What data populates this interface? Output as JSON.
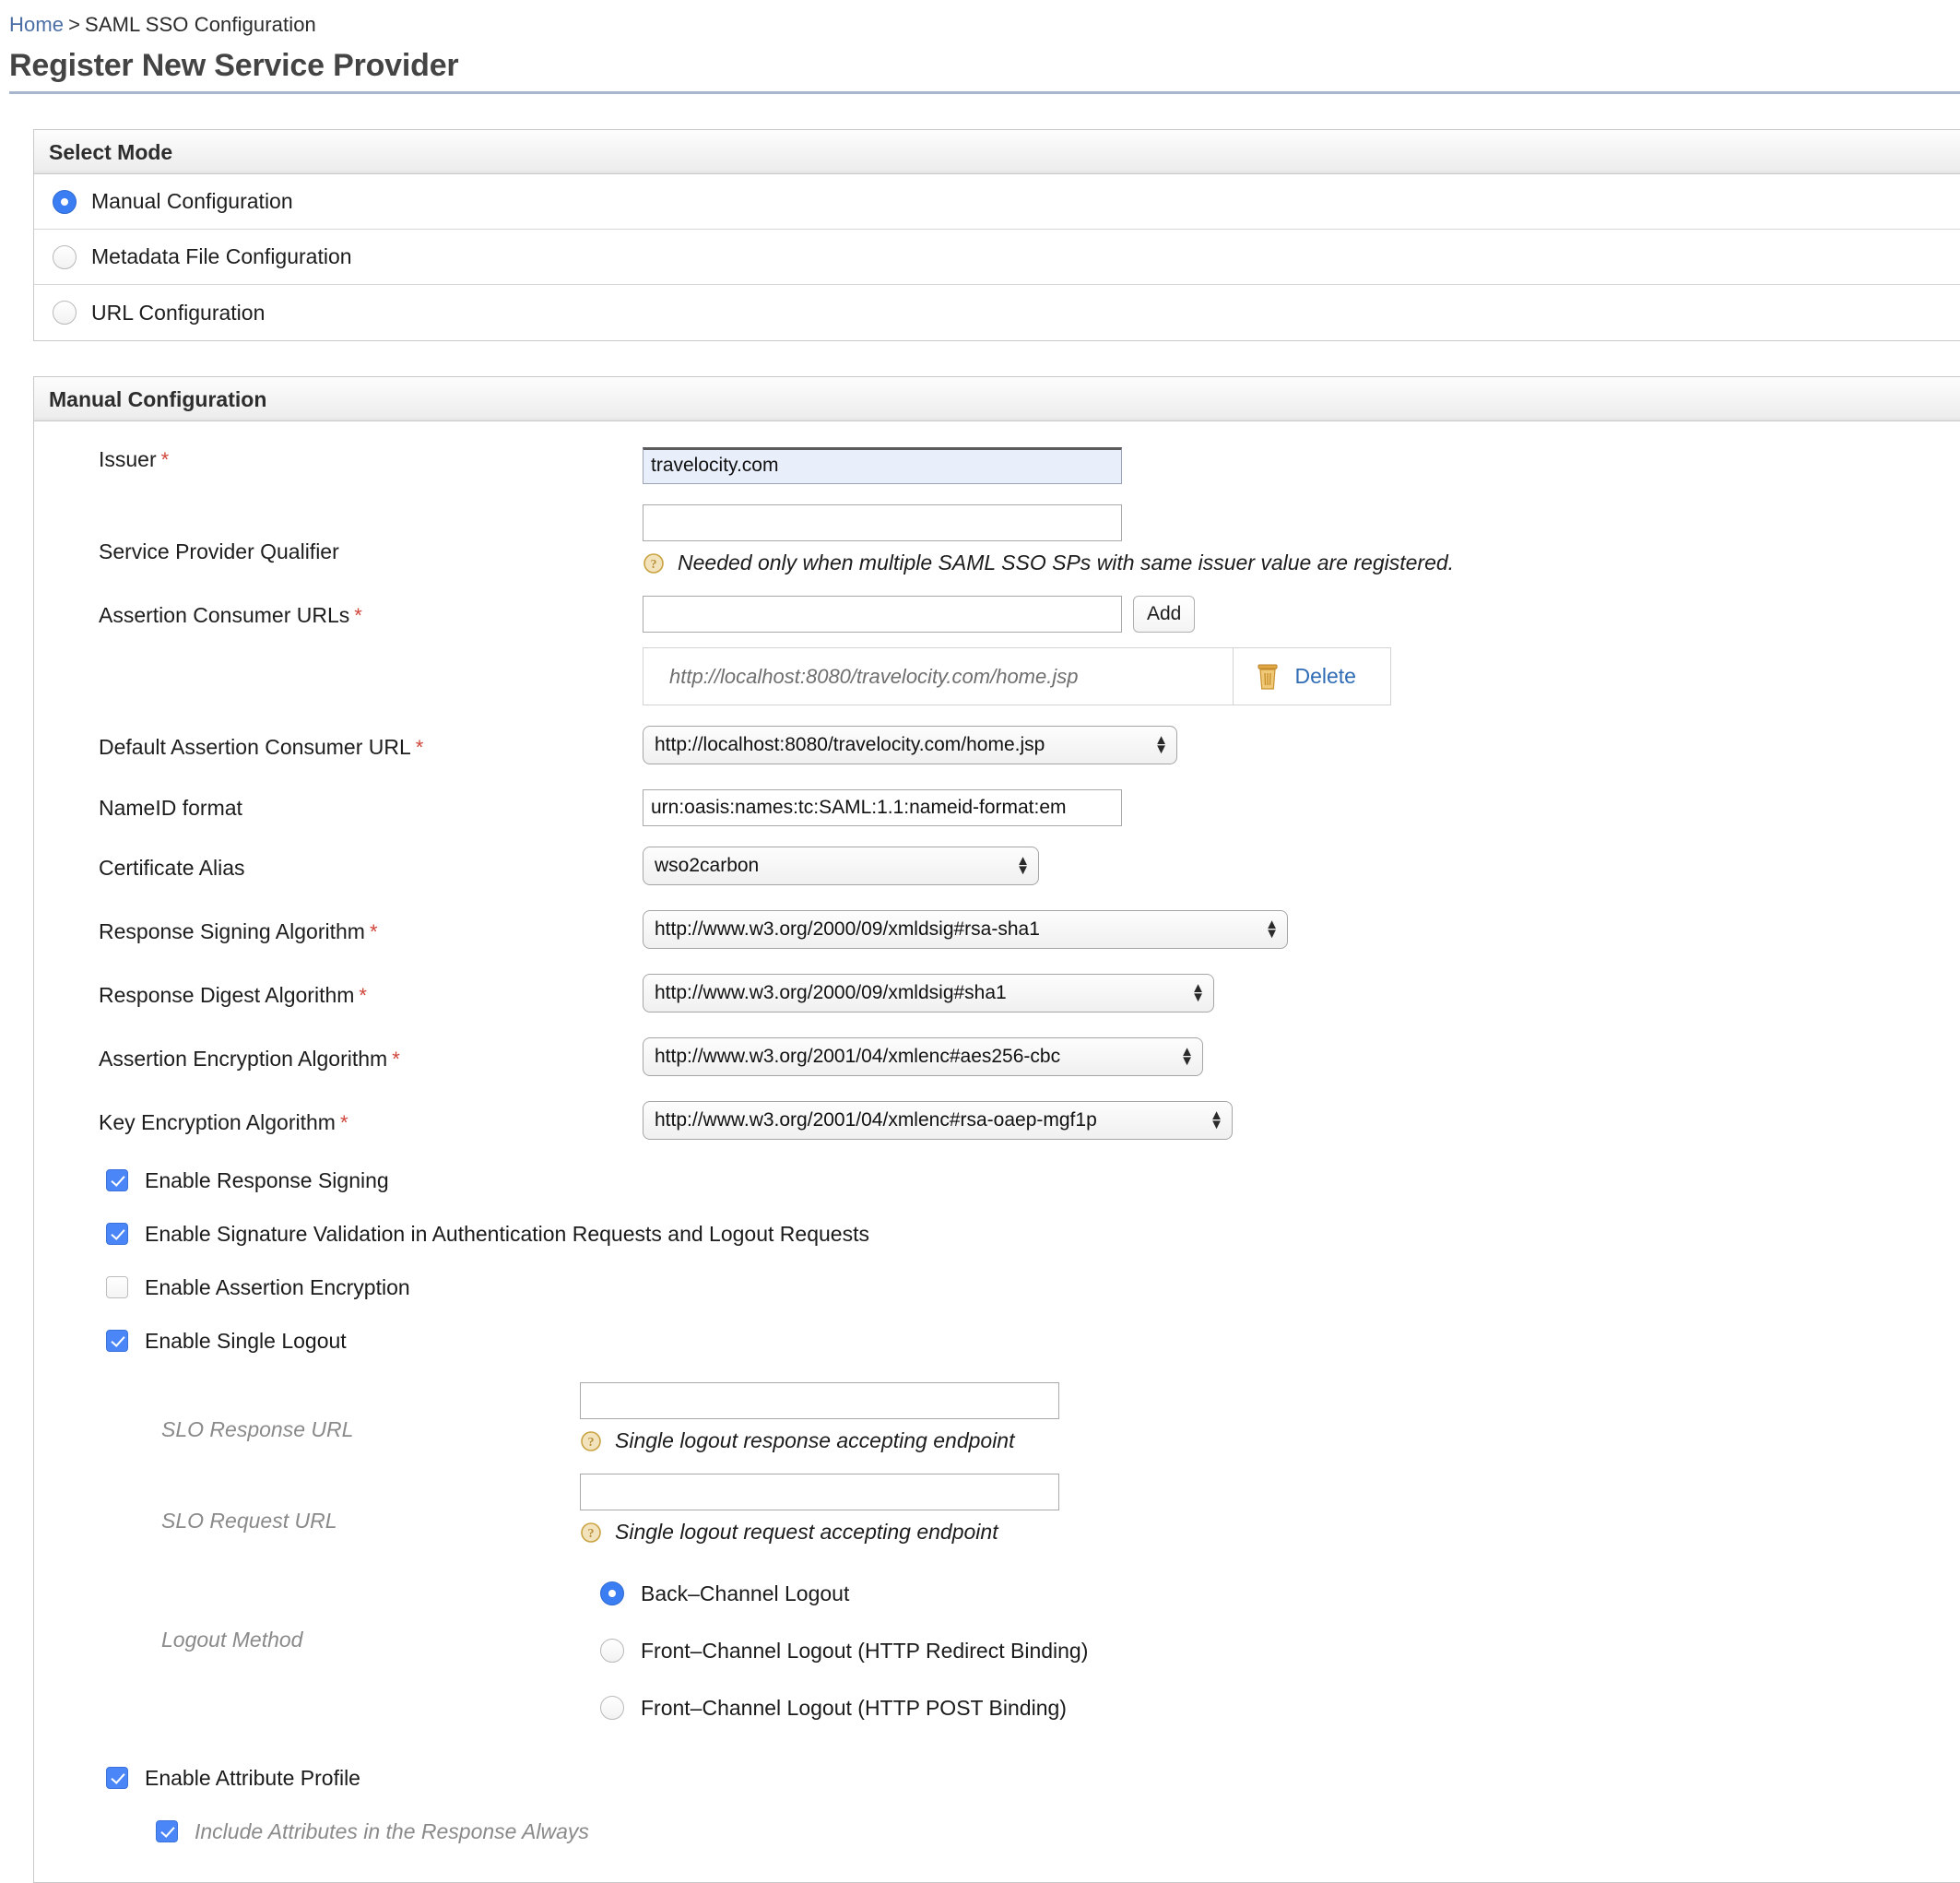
{
  "breadcrumb": {
    "home": "Home",
    "separator": ">",
    "current": "SAML SSO Configuration"
  },
  "page_title": "Register New Service Provider",
  "select_mode_panel": {
    "header": "Select Mode",
    "options": [
      {
        "label": "Manual Configuration",
        "selected": true
      },
      {
        "label": "Metadata File Configuration",
        "selected": false
      },
      {
        "label": "URL Configuration",
        "selected": false
      }
    ]
  },
  "manual_panel": {
    "header": "Manual Configuration",
    "issuer": {
      "label": "Issuer",
      "required": "*",
      "value": "travelocity.com"
    },
    "sp_qualifier": {
      "label": "Service Provider Qualifier",
      "value": "",
      "hint": "Needed only when multiple SAML SSO SPs with same issuer value are registered.",
      "hint_icon": "help-question-icon"
    },
    "assertion_consumer_urls": {
      "label": "Assertion Consumer URLs",
      "required": "*",
      "value": "",
      "add_label": "Add",
      "rows": [
        {
          "url": "http://localhost:8080/travelocity.com/home.jsp",
          "delete_label": "Delete",
          "delete_icon": "trash-icon"
        }
      ]
    },
    "default_acs": {
      "label": "Default Assertion Consumer URL",
      "required": "*",
      "value": "http://localhost:8080/travelocity.com/home.jsp"
    },
    "nameid_format": {
      "label": "NameID format",
      "value": "urn:oasis:names:tc:SAML:1.1:nameid-format:em"
    },
    "certificate_alias": {
      "label": "Certificate Alias",
      "value": "wso2carbon"
    },
    "response_signing_algorithm": {
      "label": "Response Signing Algorithm",
      "required": "*",
      "value": "http://www.w3.org/2000/09/xmldsig#rsa-sha1"
    },
    "response_digest_algorithm": {
      "label": "Response Digest Algorithm",
      "required": "*",
      "value": "http://www.w3.org/2000/09/xmldsig#sha1"
    },
    "assertion_encryption_algorithm": {
      "label": "Assertion Encryption Algorithm",
      "required": "*",
      "value": "http://www.w3.org/2001/04/xmlenc#aes256-cbc"
    },
    "key_encryption_algorithm": {
      "label": "Key Encryption Algorithm",
      "required": "*",
      "value": "http://www.w3.org/2001/04/xmlenc#rsa-oaep-mgf1p"
    },
    "checkboxes": [
      {
        "label": "Enable Response Signing",
        "checked": true
      },
      {
        "label": "Enable Signature Validation in Authentication Requests and Logout Requests",
        "checked": true
      },
      {
        "label": "Enable Assertion Encryption",
        "checked": false
      },
      {
        "label": "Enable Single Logout",
        "checked": true
      }
    ],
    "slo_response_url": {
      "label": "SLO Response URL",
      "value": "",
      "hint": "Single logout response accepting endpoint",
      "hint_icon": "help-question-icon"
    },
    "slo_request_url": {
      "label": "SLO Request URL",
      "value": "",
      "hint": "Single logout request accepting endpoint",
      "hint_icon": "help-question-icon"
    },
    "logout_method": {
      "label": "Logout Method",
      "options": [
        {
          "label": "Back–Channel Logout",
          "selected": true
        },
        {
          "label": "Front–Channel Logout (HTTP Redirect Binding)",
          "selected": false
        },
        {
          "label": "Front–Channel Logout (HTTP POST Binding)",
          "selected": false
        }
      ]
    },
    "enable_attribute_profile": {
      "label": "Enable Attribute Profile",
      "checked": true
    },
    "include_attributes_always": {
      "label": "Include Attributes in the Response Always",
      "checked": true
    }
  },
  "colors": {
    "link": "#4a6fa5",
    "required_star": "#d0453a",
    "accent_blue": "#3b7df3",
    "delete_link": "#2f6cb5",
    "focus_field_bg": "#e9eefb",
    "title_rule": "#a8b6cd"
  }
}
